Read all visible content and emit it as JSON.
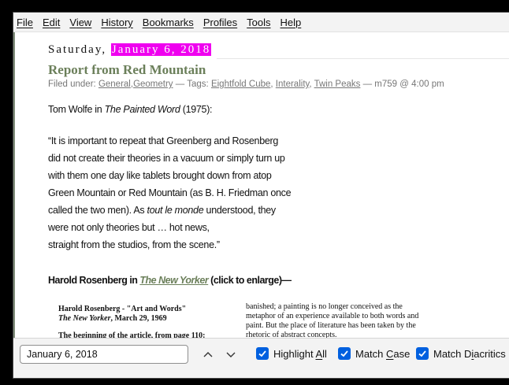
{
  "menubar": {
    "items": [
      {
        "pre": "",
        "key": "F",
        "post": "ile"
      },
      {
        "pre": "",
        "key": "E",
        "post": "dit"
      },
      {
        "pre": "",
        "key": "V",
        "post": "iew"
      },
      {
        "pre": "Hi",
        "key": "s",
        "post": "tory"
      },
      {
        "pre": "",
        "key": "B",
        "post": "ookmarks"
      },
      {
        "pre": "",
        "key": "P",
        "post": "rofiles"
      },
      {
        "pre": "",
        "key": "T",
        "post": "ools"
      },
      {
        "pre": "",
        "key": "H",
        "post": "elp"
      }
    ]
  },
  "post": {
    "day": "Saturday,",
    "date": "January 6, 2018",
    "title": "Report from Red Mountain",
    "meta": {
      "filed_under": "Filed under:",
      "categories": [
        "General",
        "Geometry"
      ],
      "tags_label": "— Tags:",
      "tags": [
        "Eightfold Cube",
        "Interality",
        "Twin Peaks"
      ],
      "byline": "— m759 @ 4:00 pm"
    },
    "intro": {
      "pre": "Tom Wolfe in ",
      "book": "The Painted Word",
      "post": " (1975):"
    },
    "quote": {
      "line1": "“It is important to repeat that Greenberg and Rosenberg",
      "line2": "did not create their theories in a vacuum or simply turn up",
      "line3": "with them one day like tablets brought down from atop",
      "line4": "Green Mountain or Red Mountain (as B. H. Friedman once",
      "line5_pre": "called the two men). As ",
      "line5_em": "tout le monde",
      "line5_post": " understood, they",
      "line6": "were not only theories but … hot news,",
      "line7": "straight from the studios, from the scene.”"
    },
    "rosenberg": {
      "pre": "Harold Rosenberg in ",
      "link": "The New Yorker",
      "post": " (click to enlarge)—"
    },
    "clipping": {
      "left_title": "Harold Rosenberg - \"Art and Words\"",
      "left_pub": "The New Yorker",
      "left_date": ", March 29, 1969",
      "left_beginning": "The beginning of the article, from page 110:",
      "right_line1": "banished; a painting is no longer conceived as the",
      "right_line2": "metaphor of an experience available to both words and",
      "right_line3": "paint. But the place of literature has been taken by the",
      "right_line4": "rhetoric of abstract concepts."
    }
  },
  "findbar": {
    "value": "January 6, 2018",
    "highlight_all": {
      "pre": "Highlight ",
      "key": "A",
      "post": "ll"
    },
    "match_case": {
      "pre": "Match ",
      "key": "C",
      "post": "ase"
    },
    "match_diacritics": {
      "pre": "Match D",
      "key": "i",
      "post": "acritics"
    }
  },
  "colors": {
    "highlight": "#ef00ef",
    "title": "#6b7f5a",
    "checkbox": "#0060df"
  }
}
